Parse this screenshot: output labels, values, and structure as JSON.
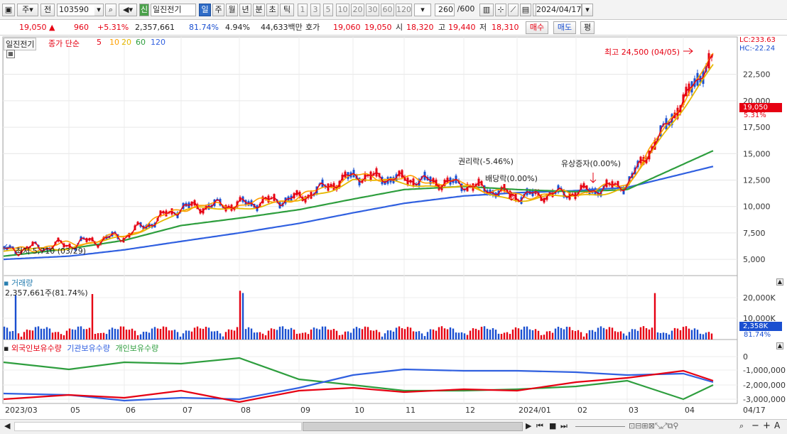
{
  "toolbar": {
    "market": "주",
    "mode": "전",
    "code": "103590",
    "name_badge": "신",
    "name": "일진전기",
    "periods": [
      "일",
      "주",
      "월",
      "년",
      "분",
      "초",
      "틱"
    ],
    "minute_steps": [
      "1",
      "3",
      "5",
      "10",
      "20",
      "30",
      "60",
      "120"
    ],
    "count": "260",
    "count_max": "/600",
    "date": "2024/04/17"
  },
  "quote": {
    "price": "19,050",
    "change": "960",
    "change_pct": "+5.31%",
    "volume": "2,357,661",
    "vol_ratio": "81.74%",
    "turnover": "4.94%",
    "amount": "44,633백만",
    "bid_label": "호가",
    "ask": "19,060",
    "bid": "19,050",
    "open_label": "시",
    "open": "18,320",
    "high_label": "고",
    "high": "19,440",
    "low_label": "저",
    "low": "18,310",
    "buy": "매수",
    "sell": "매도",
    "eval": "평"
  },
  "price_pane": {
    "title": "일진전기",
    "legend_ma_label": "종가 단순",
    "ma_periods": [
      "5",
      "10",
      "20",
      "60",
      "120"
    ],
    "lc": "LC:233.63",
    "hc": "HC:-22.24",
    "high_note": "최고 24,500 (04/05)",
    "low_note": "최저 5,710 (03/29)",
    "event1": "권리락(-5.46%)",
    "event2": "배당락(0.00%)",
    "event3": "유상증자(0.00%)",
    "last_price_tag": "19,050",
    "last_pct_tag": "5.31%",
    "y_ticks": [
      "22,500",
      "20,000",
      "17,500",
      "15,000",
      "12,500",
      "10,000",
      "7,500",
      "5,000"
    ]
  },
  "volume_pane": {
    "title": "거래량",
    "value": "2,357,661주(81.74%)",
    "y_ticks": [
      "20,000K",
      "10,000K"
    ],
    "tag_value": "2,358K",
    "tag_pct": "81.74%"
  },
  "holdings_pane": {
    "series": [
      "외국인보유수량",
      "기관보유수량",
      "개인보유수량"
    ],
    "y_ticks": [
      "0",
      "-1,000,000",
      "-2,000,000",
      "-3,000,000"
    ]
  },
  "x_axis": [
    "2023/03",
    "05",
    "06",
    "07",
    "08",
    "09",
    "10",
    "11",
    "12",
    "2024/01",
    "02",
    "03",
    "04",
    "04/17"
  ],
  "colors": {
    "up": "#e60012",
    "down": "#1a4fd0",
    "ma5": "#e60012",
    "ma10": "#ff9f00",
    "ma20": "#e6b800",
    "ma60": "#2e9e3e",
    "ma120": "#3060e0",
    "foreign": "#e60012",
    "inst": "#3060e0",
    "indiv": "#2e9e3e"
  },
  "chart_data": {
    "type": "line",
    "x": [
      "2023/03",
      "05",
      "06",
      "07",
      "08",
      "09",
      "10",
      "11",
      "12",
      "2024/01",
      "02",
      "03",
      "04"
    ],
    "series": [
      {
        "name": "5",
        "values": [
          5800,
          6400,
          7200,
          9900,
          10200,
          10800,
          12900,
          12600,
          12100,
          11000,
          11300,
          12100,
          20000
        ]
      },
      {
        "name": "60",
        "values": [
          5300,
          6000,
          6800,
          8200,
          8900,
          9700,
          10700,
          11600,
          11900,
          11600,
          11400,
          11600,
          14000
        ]
      },
      {
        "name": "120",
        "values": [
          5000,
          5300,
          5900,
          6700,
          7500,
          8400,
          9400,
          10300,
          11000,
          11300,
          11500,
          11800,
          13100
        ]
      }
    ],
    "ylim": [
      4000,
      25500
    ]
  }
}
